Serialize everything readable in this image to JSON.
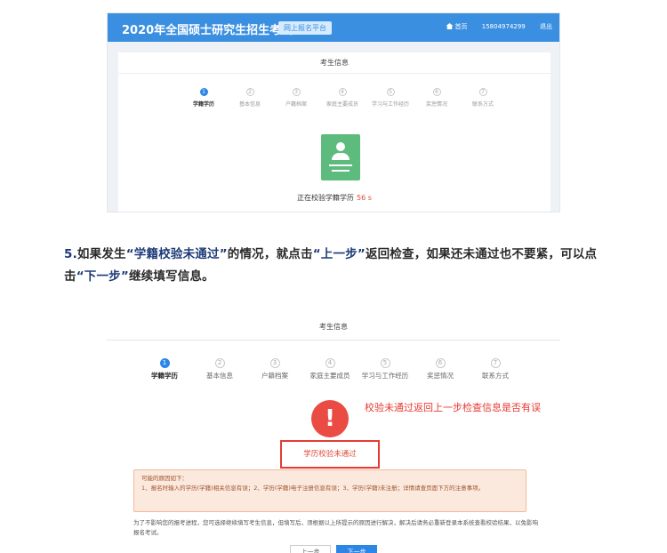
{
  "top_screenshot": {
    "site_title": "2020年全国硕士研究生招生考试",
    "site_tag": "网上报名平台",
    "nav": {
      "home": "首页",
      "phone": "15804974299",
      "logout": "退出"
    },
    "panel_title": "考生信息",
    "steps": [
      {
        "num": "1",
        "label": "学籍学历"
      },
      {
        "num": "2",
        "label": "基本信息"
      },
      {
        "num": "3",
        "label": "户籍档案"
      },
      {
        "num": "4",
        "label": "家庭主要成员"
      },
      {
        "num": "5",
        "label": "学习与工作经历"
      },
      {
        "num": "6",
        "label": "奖惩情况"
      },
      {
        "num": "7",
        "label": "联系方式"
      }
    ],
    "verifying_text": "正在校验学籍学历",
    "seconds": "56 s"
  },
  "paragraph": {
    "num": "5.",
    "t1": "如果发生",
    "q1": "“学籍校验未通过”",
    "t2": "的情况，就点击",
    "q2": "“上一步”",
    "t3": "返回检查，如果还未通过也不要紧，可以点击",
    "q3": "“下一步”",
    "t4": "继续填写信息。"
  },
  "bottom_screenshot": {
    "panel_title": "考生信息",
    "steps": [
      {
        "num": "1",
        "label": "学籍学历"
      },
      {
        "num": "2",
        "label": "基本信息"
      },
      {
        "num": "3",
        "label": "户籍档案"
      },
      {
        "num": "4",
        "label": "家庭主要成员"
      },
      {
        "num": "5",
        "label": "学习与工作经历"
      },
      {
        "num": "6",
        "label": "奖惩情况"
      },
      {
        "num": "7",
        "label": "联系方式"
      }
    ],
    "warning_symbol": "!",
    "annotation": "校验未通过返回上一步检查信息是否有误",
    "fail_text": "学历校验未通过",
    "reason_title": "可能的原因如下：",
    "reason_body": "1、报名时输入的学历(学籍)相关信息有误；2、学历(学籍)电子注册信息有误；3、学历(学籍)未注册；详情请查页面下方的注意事项。",
    "note": "为了不影响您的报考进程，您可选择继续填写考生信息，但填写后，须根据以上所提示的原因进行解决，解决后请务必重新登录本系统查看校验结果，以免影响报名考试。",
    "prev_button": "上一步",
    "next_button": "下一步"
  }
}
